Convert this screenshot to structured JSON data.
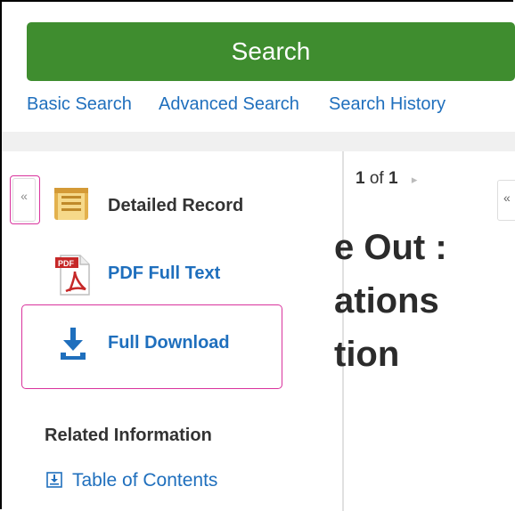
{
  "search": {
    "button_label": "Search"
  },
  "nav_links": [
    "Basic Search",
    "Advanced Search",
    "Search History"
  ],
  "sidebar": {
    "collapse_glyph": "«",
    "items": [
      {
        "label": "Detailed Record",
        "icon": "detailed-record-icon"
      },
      {
        "label": "PDF Full Text",
        "icon": "pdf-icon"
      },
      {
        "label": "Full Download",
        "icon": "download-icon"
      }
    ],
    "related_heading": "Related Information",
    "related_links": [
      {
        "label": "Table of Contents",
        "icon": "toc-icon"
      }
    ]
  },
  "content": {
    "pager": {
      "current": "1",
      "of_label": "of",
      "total": "1"
    },
    "collapse_glyph": "«",
    "title_lines": [
      "e Out :",
      "ations",
      "tion"
    ]
  },
  "colors": {
    "search_green": "#3f8d2f",
    "link_blue": "#1f6fbd",
    "highlight_magenta": "#d9339d",
    "pdf_red": "#c62828",
    "record_gold": "#e3b14d"
  }
}
